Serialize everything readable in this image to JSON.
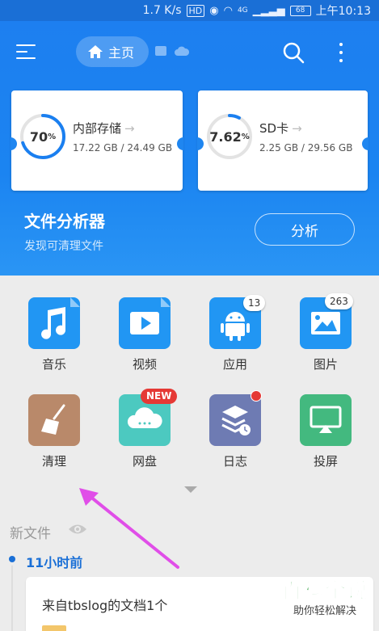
{
  "status_bar": {
    "speed": "1.7 K/s",
    "hd": "HD",
    "network": "4G",
    "battery": "68",
    "time": "上午10:13"
  },
  "toolbar": {
    "home_label": "主页"
  },
  "storage": {
    "internal": {
      "percent_label": "70",
      "percent": 70,
      "title": "内部存储",
      "usage": "17.22 GB / 24.49 GB"
    },
    "sd": {
      "percent_label": "7.62",
      "percent": 7.62,
      "title": "SD卡",
      "usage": "2.25 GB / 29.56 GB"
    },
    "percent_sign": "%"
  },
  "analyzer": {
    "title": "文件分析器",
    "subtitle": "发现可清理文件",
    "button": "分析"
  },
  "grid": {
    "music": "音乐",
    "video": "视频",
    "apps": "应用",
    "apps_badge": "13",
    "images": "图片",
    "images_badge": "263",
    "clean": "清理",
    "cloud": "网盘",
    "cloud_badge": "NEW",
    "log": "日志",
    "cast": "投屏"
  },
  "recent": {
    "section": "新文件",
    "time_group": "11小时前",
    "file_title": "来自tbslog的文档1个"
  },
  "watermark": {
    "main": "百科全说",
    "sub": "助你轻松解决"
  },
  "colors": {
    "primary": "#1a6fd6",
    "accent_green": "#3aa54a",
    "badge_red": "#e53935"
  }
}
